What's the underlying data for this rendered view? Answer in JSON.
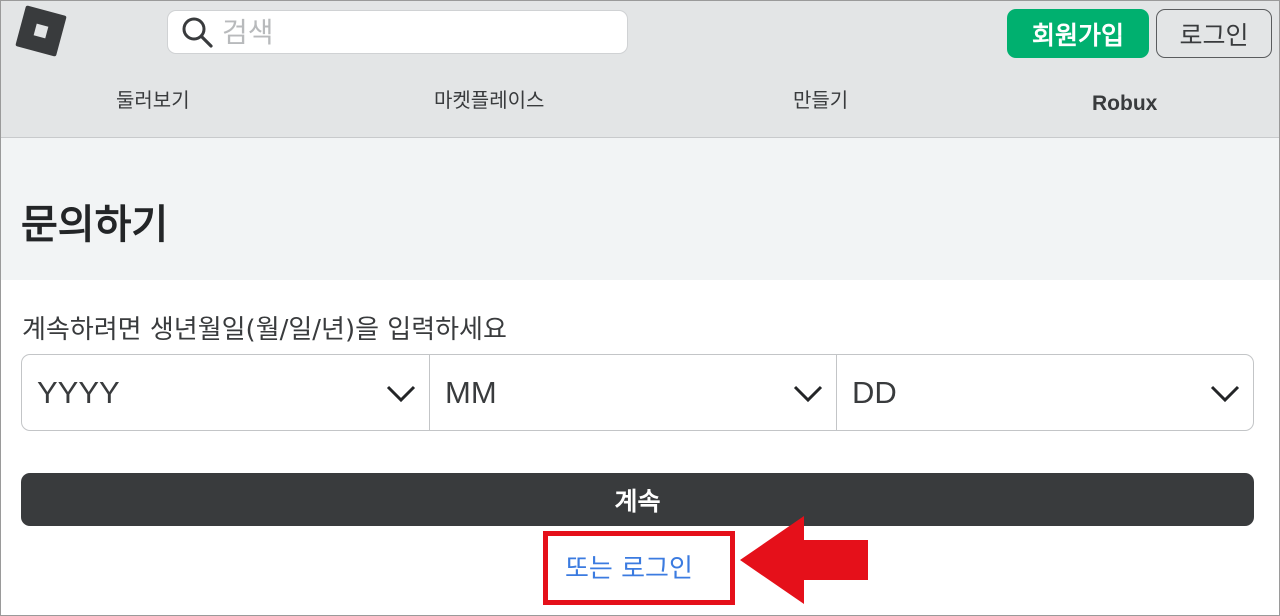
{
  "header": {
    "search": {
      "placeholder": "검색",
      "icon": "search-icon"
    },
    "signup_label": "회원가입",
    "login_label": "로그인",
    "brand_color": "#00b06f",
    "nav": [
      {
        "label": "둘러보기"
      },
      {
        "label": "마켓플레이스"
      },
      {
        "label": "만들기"
      },
      {
        "label": "Robux"
      }
    ]
  },
  "page": {
    "title": "문의하기",
    "prompt": "계속하려면 생년월일(월/일/년)을 입력하세요",
    "date_selects": [
      {
        "value": "YYYY"
      },
      {
        "value": "MM"
      },
      {
        "value": "DD"
      }
    ],
    "continue_label": "계속",
    "login_link": "또는 로그인"
  },
  "annotation": {
    "color": "#e5101a"
  }
}
